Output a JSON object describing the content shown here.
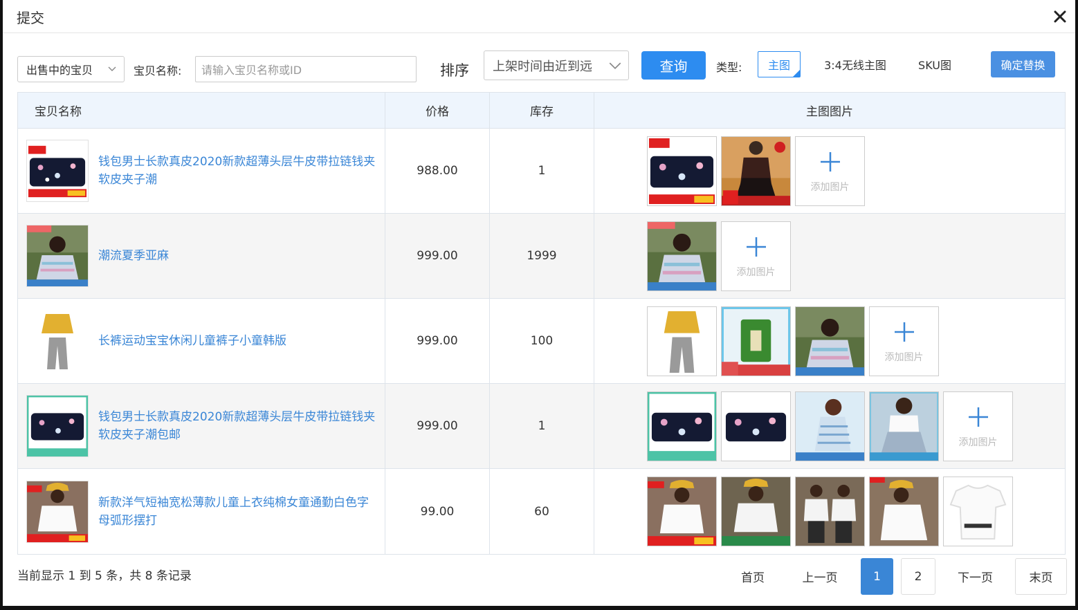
{
  "dialog": {
    "title": "提交"
  },
  "toolbar": {
    "status_select": "出售中的宝贝",
    "name_label": "宝贝名称:",
    "name_placeholder": "请输入宝贝名称或ID",
    "sort_label": "排序",
    "sort_select": "上架时间由近到远",
    "query_button": "查询",
    "type_label": "类型:",
    "type_options": [
      "主图",
      "3:4无线主图",
      "SKU图"
    ],
    "confirm_button": "确定替换"
  },
  "table": {
    "headers": [
      "宝贝名称",
      "价格",
      "库存",
      "主图图片"
    ],
    "add_image_label": "添加图片",
    "rows": [
      {
        "name": "钱包男士长款真皮2020新款超薄头层牛皮带拉链钱夹软皮夹子潮",
        "price": "988.00",
        "stock": "1",
        "images": 2
      },
      {
        "name": "潮流夏季亚麻",
        "price": "999.00",
        "stock": "1999",
        "images": 1
      },
      {
        "name": "长裤运动宝宝休闲儿童裤子小童韩版",
        "price": "999.00",
        "stock": "100",
        "images": 3
      },
      {
        "name": "钱包男士长款真皮2020新款超薄头层牛皮带拉链钱夹软皮夹子潮包邮",
        "price": "999.00",
        "stock": "1",
        "images": 4
      },
      {
        "name": "新款洋气短袖宽松薄款儿童上衣纯棉女童通勤白色字母弧形摆打",
        "price": "99.00",
        "stock": "60",
        "images": 5
      }
    ]
  },
  "footer": {
    "record_info": "当前显示 1 到 5 条，共 8 条记录",
    "pager": {
      "first": "首页",
      "prev": "上一页",
      "pages": [
        "1",
        "2"
      ],
      "next": "下一页",
      "last": "末页"
    }
  },
  "colors": {
    "accent": "#2d8cf0",
    "link": "#3a86d6",
    "header_bg": "#eef5fd"
  }
}
